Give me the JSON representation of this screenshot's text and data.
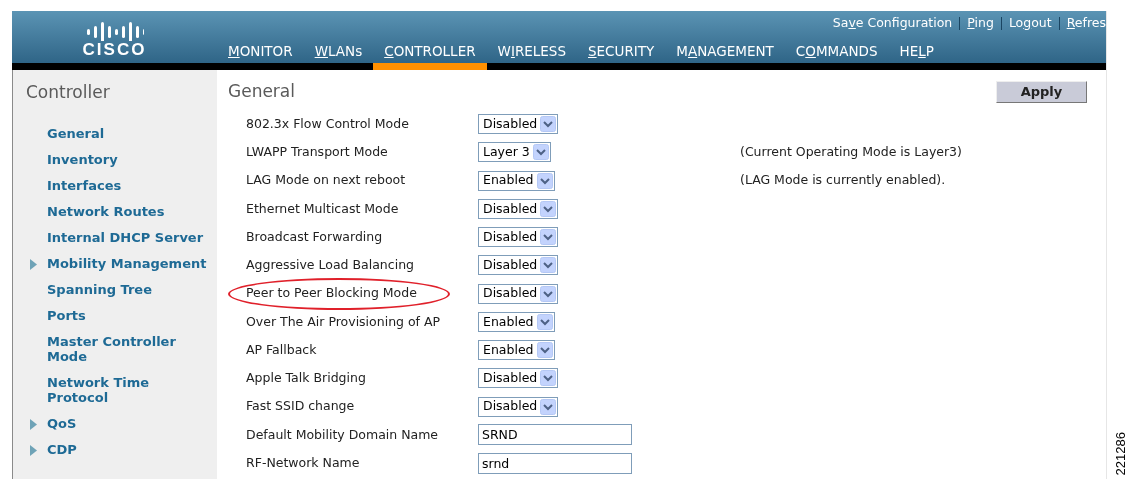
{
  "header": {
    "logo": "CISCO",
    "top_links": [
      {
        "before": "Sa",
        "key": "v",
        "after": "e Configuration"
      },
      {
        "key": "P",
        "after": "ing"
      },
      {
        "before": "Lo",
        "key": "g",
        "after": "out"
      },
      {
        "key": "R",
        "after": "efres"
      }
    ],
    "nav": [
      {
        "key": "M",
        "after": "ONITOR",
        "selected": false
      },
      {
        "key": "W",
        "after": "LANs",
        "selected": false
      },
      {
        "key": "C",
        "after": "ONTROLLER",
        "selected": true
      },
      {
        "before": "W",
        "key": "I",
        "after": "RELESS",
        "selected": false
      },
      {
        "key": "S",
        "after": "ECURITY",
        "selected": false
      },
      {
        "before": "M",
        "key": "A",
        "after": "NAGEMENT",
        "selected": false
      },
      {
        "before": "C",
        "key": "O",
        "after": "MMANDS",
        "selected": false
      },
      {
        "before": "HE",
        "key": "L",
        "after": "P",
        "selected": false
      }
    ]
  },
  "sidebar": {
    "title": "Controller",
    "items": [
      {
        "label": "General",
        "expandable": false
      },
      {
        "label": "Inventory",
        "expandable": false
      },
      {
        "label": "Interfaces",
        "expandable": false
      },
      {
        "label": "Network Routes",
        "expandable": false
      },
      {
        "label": "Internal DHCP Server",
        "expandable": false
      },
      {
        "label": "Mobility Management",
        "expandable": true
      },
      {
        "label": "Spanning Tree",
        "expandable": false
      },
      {
        "label": "Ports",
        "expandable": false
      },
      {
        "label": "Master Controller Mode",
        "expandable": false
      },
      {
        "label": "Network Time Protocol",
        "expandable": false
      },
      {
        "label": "QoS",
        "expandable": true
      },
      {
        "label": "CDP",
        "expandable": true
      }
    ]
  },
  "main": {
    "title": "General",
    "apply_button": "Apply",
    "settings": [
      {
        "label": "802.3x Flow Control Mode",
        "kind": "select",
        "value": "Disabled",
        "highlighted": false
      },
      {
        "label": "LWAPP Transport Mode",
        "kind": "select",
        "value": "Layer 3",
        "note": "(Current Operating Mode is Layer3)",
        "highlighted": false
      },
      {
        "label": "LAG Mode on next reboot",
        "kind": "select",
        "value": "Enabled",
        "note": "(LAG Mode is currently enabled).",
        "highlighted": false
      },
      {
        "label": "Ethernet Multicast Mode",
        "kind": "select",
        "value": "Disabled",
        "highlighted": false
      },
      {
        "label": "Broadcast Forwarding",
        "kind": "select",
        "value": "Disabled",
        "highlighted": false
      },
      {
        "label": "Aggressive Load Balancing",
        "kind": "select",
        "value": "Disabled",
        "highlighted": false
      },
      {
        "label": "Peer to Peer Blocking Mode",
        "kind": "select",
        "value": "Disabled",
        "highlighted": true
      },
      {
        "label": "Over The Air Provisioning of AP",
        "kind": "select",
        "value": "Enabled",
        "highlighted": false
      },
      {
        "label": "AP Fallback",
        "kind": "select",
        "value": "Enabled",
        "highlighted": false
      },
      {
        "label": "Apple Talk Bridging",
        "kind": "select",
        "value": "Disabled",
        "highlighted": false
      },
      {
        "label": "Fast SSID change",
        "kind": "select",
        "value": "Disabled",
        "highlighted": false
      },
      {
        "label": "Default Mobility Domain Name",
        "kind": "text",
        "value": "SRND",
        "highlighted": false
      },
      {
        "label": "RF-Network Name",
        "kind": "text",
        "value": "srnd",
        "highlighted": false
      }
    ]
  },
  "figure_number": "221286"
}
